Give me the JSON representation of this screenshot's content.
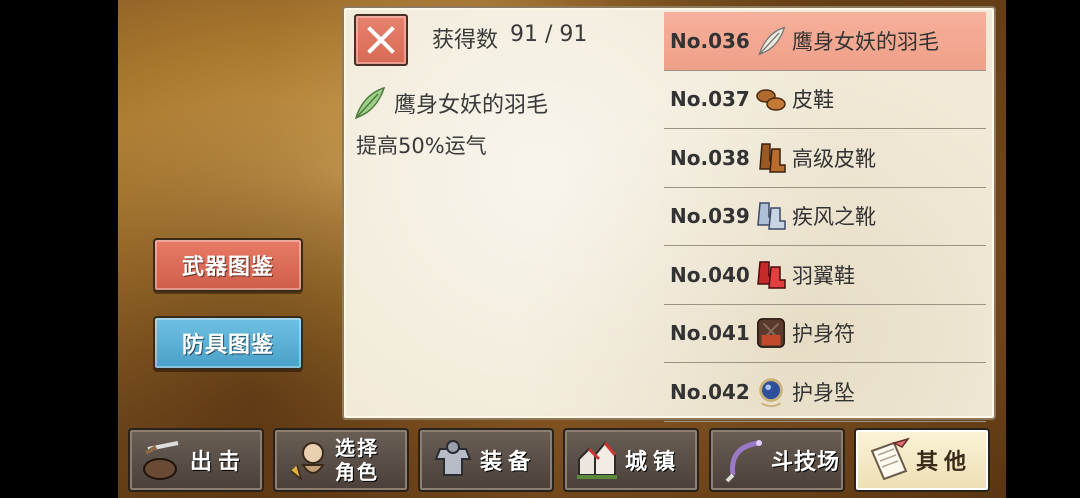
{
  "left_menu": {
    "weapon_label": "武器图鉴",
    "armor_label": "防具图鉴"
  },
  "detail": {
    "count_label": "获得数",
    "count_value": "91 / 91",
    "item_name": "鹰身女妖的羽毛",
    "item_icon": "feather-icon",
    "description": "提高50%运气"
  },
  "items": [
    {
      "no": "No.036",
      "name": "鹰身女妖的羽毛",
      "icon": "feather-icon",
      "selected": true
    },
    {
      "no": "No.037",
      "name": "皮鞋",
      "icon": "leather-shoes-icon"
    },
    {
      "no": "No.038",
      "name": "高级皮靴",
      "icon": "leather-boots-icon"
    },
    {
      "no": "No.039",
      "name": "疾风之靴",
      "icon": "wind-boots-icon"
    },
    {
      "no": "No.040",
      "name": "羽翼鞋",
      "icon": "wing-shoes-icon"
    },
    {
      "no": "No.041",
      "name": "护身符",
      "icon": "amulet-icon"
    },
    {
      "no": "No.042",
      "name": "护身坠",
      "icon": "pendant-icon"
    }
  ],
  "nav": [
    {
      "label": "出击",
      "icon": "sortie-icon"
    },
    {
      "label": "选择角色",
      "line1": "选择",
      "line2": "角色",
      "icon": "character-icon"
    },
    {
      "label": "装备",
      "icon": "armor-icon"
    },
    {
      "label": "城镇",
      "icon": "town-icon"
    },
    {
      "label": "斗技场",
      "icon": "arena-icon"
    },
    {
      "label": "其他",
      "icon": "scroll-icon",
      "active": true
    }
  ],
  "colors": {
    "weapon_button": "#d96a55",
    "armor_button": "#5bb0d6",
    "selected_row": "#f2a58e",
    "panel_bg": "#f1ead8"
  }
}
